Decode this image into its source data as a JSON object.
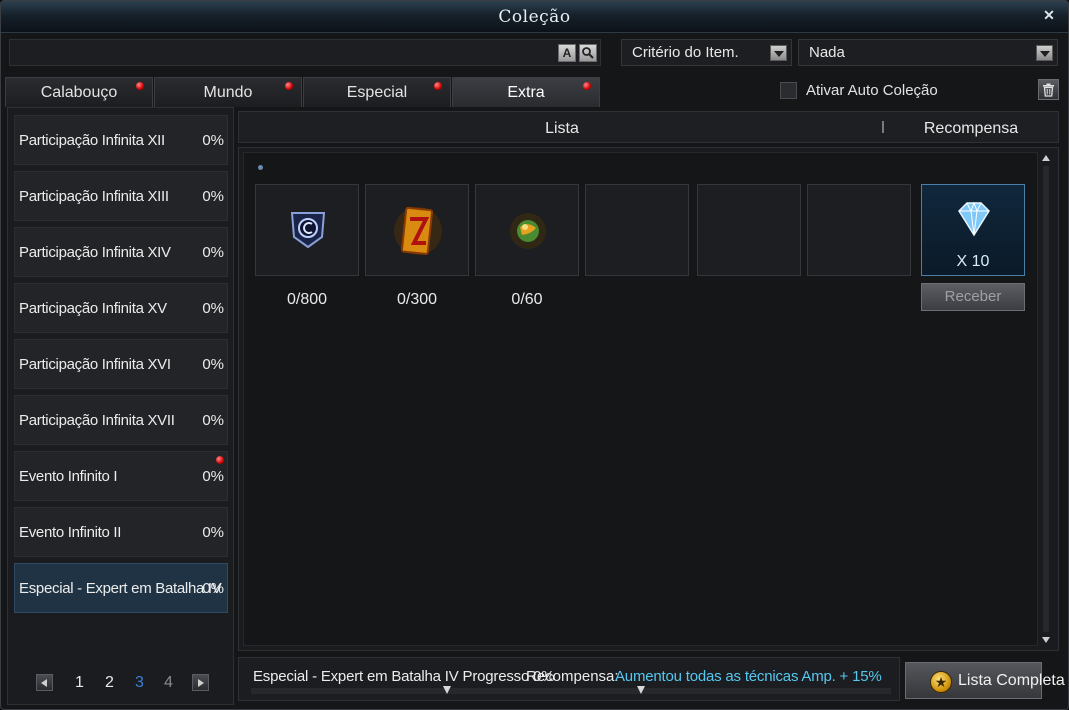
{
  "window": {
    "title": "Coleção",
    "close_icon": "close-icon"
  },
  "search": {
    "value": "",
    "placeholder": "",
    "btn_a": "A",
    "btn_search_icon": "magnifier-icon"
  },
  "filters": {
    "criteria": "Critério do Item.",
    "value": "Nada"
  },
  "tabs": [
    {
      "label": "Calabouço",
      "has_alert": true,
      "active": false
    },
    {
      "label": "Mundo",
      "has_alert": true,
      "active": false
    },
    {
      "label": "Especial",
      "has_alert": true,
      "active": false
    },
    {
      "label": "Extra",
      "has_alert": true,
      "active": true
    }
  ],
  "auto_collection": {
    "label": "Ativar Auto Coleção",
    "checked": false
  },
  "collections": [
    {
      "name": "Participação Infinita XII",
      "percent": "0%"
    },
    {
      "name": "Participação Infinita XIII",
      "percent": "0%"
    },
    {
      "name": "Participação Infinita XIV",
      "percent": "0%"
    },
    {
      "name": "Participação Infinita XV",
      "percent": "0%"
    },
    {
      "name": "Participação Infinita XVI",
      "percent": "0%"
    },
    {
      "name": "Participação Infinita XVII",
      "percent": "0%"
    },
    {
      "name": "Evento Infinito I",
      "percent": "0%",
      "has_alert": true
    },
    {
      "name": "Evento Infinito II",
      "percent": "0%"
    },
    {
      "name": "Especial - Expert em Batalha IV",
      "percent": "0%",
      "selected": true
    }
  ],
  "pagination": {
    "pages": [
      "1",
      "2",
      "3",
      "4"
    ],
    "current": "3"
  },
  "columns": {
    "list": "Lista",
    "reward": "Recompensa"
  },
  "items": [
    {
      "icon": "badge-icon",
      "count": "0/800"
    },
    {
      "icon": "scroll-icon",
      "count": "0/300"
    },
    {
      "icon": "gem-orb-icon",
      "count": "0/60"
    },
    {
      "icon": "",
      "count": ""
    },
    {
      "icon": "",
      "count": ""
    },
    {
      "icon": "",
      "count": ""
    }
  ],
  "reward": {
    "icon": "diamond-icon",
    "quantity": "X 10",
    "button": "Receber"
  },
  "progress": {
    "text": "Especial - Expert em Batalha IV Progresso 0%",
    "reward_label": "Recompensa:",
    "reward_desc": "Aumentou todas as técnicas Amp. + 15%"
  },
  "full_list_button": "Lista Completa",
  "colors": {
    "accent_blue": "#56c8f0",
    "alert_red": "#d00000",
    "page_active": "#3c7ed8"
  }
}
